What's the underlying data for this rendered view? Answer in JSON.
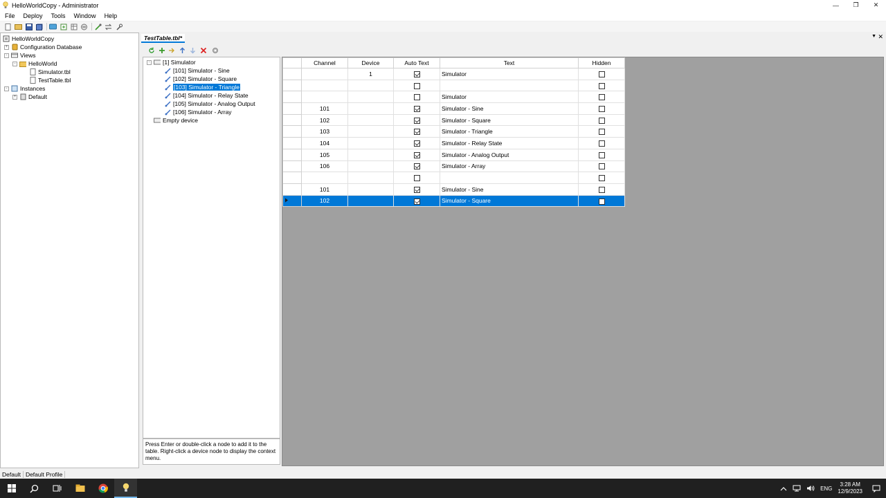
{
  "window": {
    "title": "HelloWorldCopy - Administrator"
  },
  "menu": [
    "File",
    "Deploy",
    "Tools",
    "Window",
    "Help"
  ],
  "project_tree": {
    "root": "HelloWorldCopy",
    "configuration_database": "Configuration Database",
    "views": "Views",
    "helloworld": "HelloWorld",
    "file1": "Simulator.tbl",
    "file2": "TestTable.tbl",
    "instances": "Instances",
    "default": "Default"
  },
  "document_tab": {
    "label": "TestTable.tbl*"
  },
  "device_tree": {
    "root": "[1] Simulator",
    "items": [
      "[101] Simulator - Sine",
      "[102] Simulator - Square",
      "[103] Simulator - Triangle",
      "[104] Simulator - Relay State",
      "[105] Simulator - Analog Output",
      "[106] Simulator - Array"
    ],
    "empty": "Empty device",
    "selected_index": 2
  },
  "help_text": "Press Enter or double-click a node to add it to the table. Right-click a device node to display the context menu.",
  "grid": {
    "columns": [
      "Channel",
      "Device",
      "Auto Text",
      "Text",
      "Hidden"
    ],
    "rows": [
      {
        "channel": "",
        "device": "1",
        "auto": true,
        "text": "Simulator",
        "hidden": false
      },
      {
        "channel": "",
        "device": "",
        "auto": false,
        "text": "",
        "hidden": false
      },
      {
        "channel": "",
        "device": "",
        "auto": false,
        "text": "Simulator",
        "hidden": false
      },
      {
        "channel": "101",
        "device": "",
        "auto": true,
        "text": "Simulator - Sine",
        "hidden": false
      },
      {
        "channel": "102",
        "device": "",
        "auto": true,
        "text": "Simulator - Square",
        "hidden": false
      },
      {
        "channel": "103",
        "device": "",
        "auto": true,
        "text": "Simulator - Triangle",
        "hidden": false
      },
      {
        "channel": "104",
        "device": "",
        "auto": true,
        "text": "Simulator - Relay State",
        "hidden": false
      },
      {
        "channel": "105",
        "device": "",
        "auto": true,
        "text": "Simulator - Analog Output",
        "hidden": false
      },
      {
        "channel": "106",
        "device": "",
        "auto": true,
        "text": "Simulator - Array",
        "hidden": false
      },
      {
        "channel": "",
        "device": "",
        "auto": false,
        "text": "",
        "hidden": false
      },
      {
        "channel": "101",
        "device": "",
        "auto": true,
        "text": "Simulator - Sine",
        "hidden": false
      },
      {
        "channel": "102",
        "device": "",
        "auto": true,
        "text": "Simulator - Square",
        "hidden": false,
        "selected": true
      }
    ]
  },
  "statusbar": {
    "instance": "Default",
    "profile": "Default Profile"
  },
  "taskbar": {
    "language": "ENG",
    "time": "3:28 AM",
    "date": "12/9/2023"
  },
  "colors": {
    "selection": "#0078d7",
    "taskbar": "#202020",
    "grid_background": "#a0a0a0"
  }
}
